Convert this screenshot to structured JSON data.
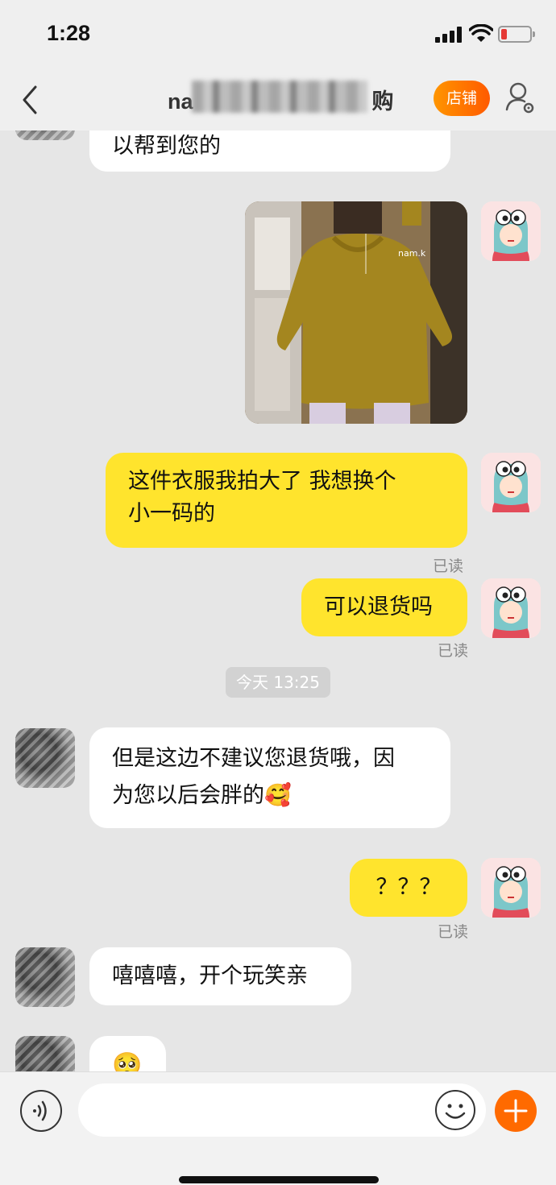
{
  "status_bar": {
    "time": "1:28"
  },
  "nav": {
    "title": "na",
    "title_suffix": "购",
    "store_button": "店铺"
  },
  "messages": {
    "m0": {
      "text": "以帮到您的"
    },
    "m2": {
      "text_line1": "这件衣服我拍大了 我想换个",
      "text_line2": "小一码的",
      "status": "已读"
    },
    "m3": {
      "text": "可以退货吗",
      "status": "已读"
    },
    "divider": {
      "text": "今天 13:25"
    },
    "m4": {
      "text_line1": "但是这边不建议您退货哦，因",
      "text_line2": "为您以后会胖的",
      "emoji": "🥰"
    },
    "m5": {
      "text": "？？？",
      "status": "已读"
    },
    "m6": {
      "text": "嘻嘻嘻，开个玩笑亲"
    },
    "m7": {
      "emoji": "🥺"
    },
    "photo_watermark": "nam.k"
  },
  "input": {
    "placeholder": ""
  },
  "icons": {
    "back": "chevron-left-icon",
    "settings": "user-settings-icon",
    "voice": "voice-icon",
    "emoji": "emoji-icon",
    "plus": "plus-icon"
  },
  "colors": {
    "accent": "#ff6a00",
    "self_bubble": "#ffe42d",
    "other_bubble": "#ffffff"
  }
}
